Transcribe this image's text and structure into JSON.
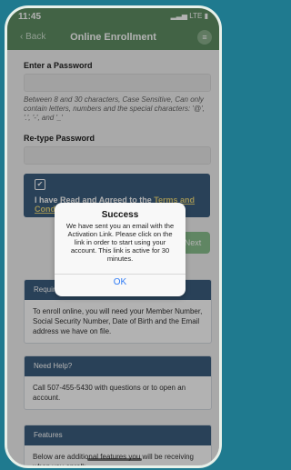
{
  "status_bar": {
    "time": "11:45",
    "network": "LTE",
    "signal_icon": "signal-bars",
    "battery_icon": "battery"
  },
  "nav": {
    "back_label": "Back",
    "title": "Online Enrollment",
    "menu_icon": "menu"
  },
  "form": {
    "password_label": "Enter a Password",
    "password_value": "",
    "password_hint": "Between 8 and 30 characters, Case Sensitive, Can only contain letters, numbers and the special characters: '@', '.', '-', and '_'",
    "retype_label": "Re-type Password",
    "retype_value": "",
    "agree_text_prefix": "I have Read and Agreed to the ",
    "agree_terms_link": "Terms and Conditions",
    "agree_checked": "✔",
    "next_label": "Next"
  },
  "sections": {
    "requirements": {
      "title": "Requirements",
      "body": "To enroll online, you will need your Member Number, Social Security Number, Date of Birth and the Email address we have on file."
    },
    "help": {
      "title": "Need Help?",
      "body": "Call 507-455-5430 with questions or to open an account."
    },
    "features": {
      "title": "Features",
      "body": "Below are additional features you will be receiving when you enroll:"
    }
  },
  "alert": {
    "title": "Success",
    "message": "We have sent you an email with the Activation Link. Please click on the link in order to start using your account. This link is active for 30 minutes.",
    "ok_label": "OK"
  },
  "colors": {
    "header_green": "#5f8f63",
    "section_blue": "#3b5d7e",
    "link_blue": "#2f7bf5"
  }
}
